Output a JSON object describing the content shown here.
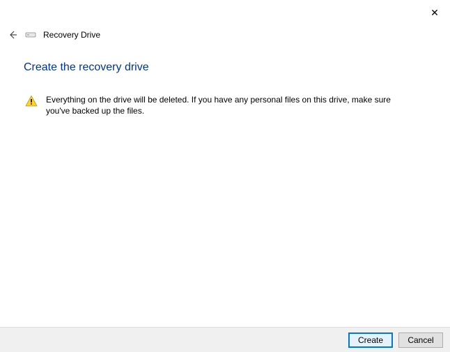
{
  "window": {
    "close_glyph": "✕"
  },
  "header": {
    "back_glyph": "←",
    "title": "Recovery Drive"
  },
  "page": {
    "title": "Create the recovery drive"
  },
  "warning": {
    "text": "Everything on the drive will be deleted. If you have any personal files on this drive, make sure you've backed up the files."
  },
  "footer": {
    "primary_label": "Create",
    "cancel_label": "Cancel"
  }
}
